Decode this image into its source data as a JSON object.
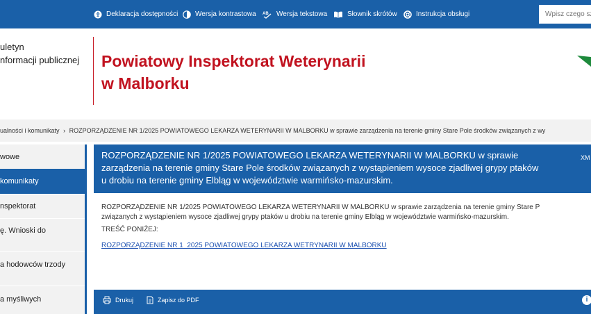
{
  "topbar": {
    "items": [
      {
        "label": "Deklaracja dostępności",
        "icon": "accessibility-icon"
      },
      {
        "label": "Wersja kontrastowa",
        "icon": "contrast-icon"
      },
      {
        "label": "Wersja tekstowa",
        "icon": "text-version-icon"
      },
      {
        "label": "Słownik skrótów",
        "icon": "book-icon"
      },
      {
        "label": "Instrukcja obsługi",
        "icon": "lifebuoy-icon"
      }
    ],
    "search_placeholder": "Wpisz czego sz"
  },
  "header": {
    "bip_line1": "uletyn",
    "bip_line2": "nformacji publicznej",
    "title_line1": "Powiatowy Inspektorat Weterynarii",
    "title_line2": "w Malborku"
  },
  "breadcrumb": {
    "part1": "ualności i komunikaty",
    "separator": "›",
    "part2": "ROZPORZĄDZENIE NR 1/2025 POWIATOWEGO LEKARZA WETERYNARII W MALBORKU w sprawie zarządzenia na terenie gminy Stare Pole środków związanych z wy"
  },
  "sidebar": {
    "items": [
      {
        "label": "wowe"
      },
      {
        "label": "komunikaty"
      },
      {
        "label": "nspektorat"
      },
      {
        "label": "ę. Wnioski do"
      },
      {
        "label": "a hodowców trzody"
      },
      {
        "label": "a myśliwych"
      }
    ]
  },
  "article": {
    "title_line1": "ROZPORZĄDZENIE NR 1/2025 POWIATOWEGO LEKARZA WETERYNARII W MALBORKU w sprawie",
    "title_line2": "zarządzenia na terenie gminy Stare Pole środków związanych z wystąpieniem wysoce zjadliwej grypy ptaków",
    "title_line3": "u drobiu na terenie gminy Elbląg w województwie warmińsko-mazurskim.",
    "xml_label": "XM",
    "body_line1": "ROZPORZĄDZENIE NR 1/2025 POWIATOWEGO LEKARZA WETERYNARII W MALBORKU w sprawie zarządzenia na terenie gminy Stare P",
    "body_line2": "związanych z wystąpieniem wysoce zjadliwej grypy ptaków u drobiu na terenie gminy Elbląg w województwie warmińsko-mazurskim.",
    "tresc": "TREŚĆ PONIŻEJ:",
    "link": "ROZPORZĄDZENIE NR 1_2025 POWIATOWEGO LEKARZA WETRYNARII W MALBORKU"
  },
  "footer": {
    "print_label": "Drukuj",
    "pdf_label": "Zapisz do PDF",
    "info_glyph": "i"
  },
  "colors": {
    "primary": "#1a60a8",
    "title_red": "#c1121f",
    "breadcrumb_bg": "#f2f2f2"
  }
}
